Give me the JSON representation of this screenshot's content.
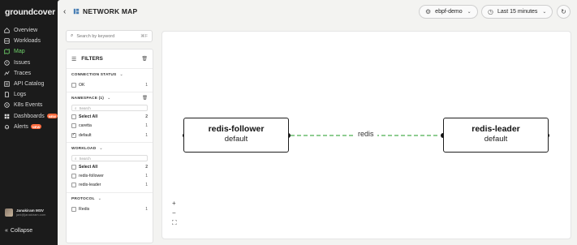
{
  "app": {
    "brand": "groundcover"
  },
  "sidebar": {
    "items": [
      {
        "label": "Overview",
        "icon": "overview-icon"
      },
      {
        "label": "Workloads",
        "icon": "workloads-icon"
      },
      {
        "label": "Map",
        "icon": "map-icon",
        "active": true
      },
      {
        "label": "Issues",
        "icon": "issues-icon"
      },
      {
        "label": "Traces",
        "icon": "traces-icon"
      },
      {
        "label": "API Catalog",
        "icon": "api-catalog-icon"
      },
      {
        "label": "Logs",
        "icon": "logs-icon"
      },
      {
        "label": "K8s Events",
        "icon": "k8s-events-icon"
      },
      {
        "label": "Dashboards",
        "icon": "dashboards-icon",
        "badge": "NEW"
      },
      {
        "label": "Alerts",
        "icon": "alerts-icon",
        "badge": "NEW"
      }
    ],
    "user": {
      "name": "Janakiram MSV",
      "email": "jani@janakiram.com"
    },
    "collapse_label": "Collapse"
  },
  "header": {
    "title": "NETWORK MAP",
    "cluster": "ebpf-demo",
    "time_range": "Last 15 minutes"
  },
  "filters": {
    "search_placeholder": "Search by keyword",
    "search_shortcut": "⌘F",
    "title": "FILTERS",
    "connection_status": {
      "title": "CONNECTION STATUS",
      "options": [
        {
          "label": "OK",
          "count": "1",
          "checked": false
        }
      ]
    },
    "namespace": {
      "title": "NAMESPACE (1)",
      "search_placeholder": "Search",
      "select_all": {
        "label": "Select All",
        "count": "2"
      },
      "options": [
        {
          "label": "caretta",
          "count": "1",
          "checked": false
        },
        {
          "label": "default",
          "count": "1",
          "checked": true
        }
      ]
    },
    "workload": {
      "title": "WORKLOAD",
      "search_placeholder": "Search",
      "select_all": {
        "label": "Select All",
        "count": "2"
      },
      "options": [
        {
          "label": "redis-follower",
          "count": "1",
          "checked": false
        },
        {
          "label": "redis-leader",
          "count": "1",
          "checked": false
        }
      ]
    },
    "protocol": {
      "title": "PROTOCOL",
      "options": [
        {
          "label": "Redis",
          "count": "1",
          "checked": false
        }
      ]
    }
  },
  "graph": {
    "nodes": [
      {
        "name": "redis-follower",
        "namespace": "default"
      },
      {
        "name": "redis-leader",
        "namespace": "default"
      }
    ],
    "edge": {
      "label": "redis",
      "color": "#4caf50"
    }
  },
  "zoom_controls": {
    "zoom_in": "+",
    "zoom_out": "−",
    "fit": "⛶"
  },
  "colors": {
    "accent": "#6fd06a",
    "badge": "#ff6b3d"
  }
}
